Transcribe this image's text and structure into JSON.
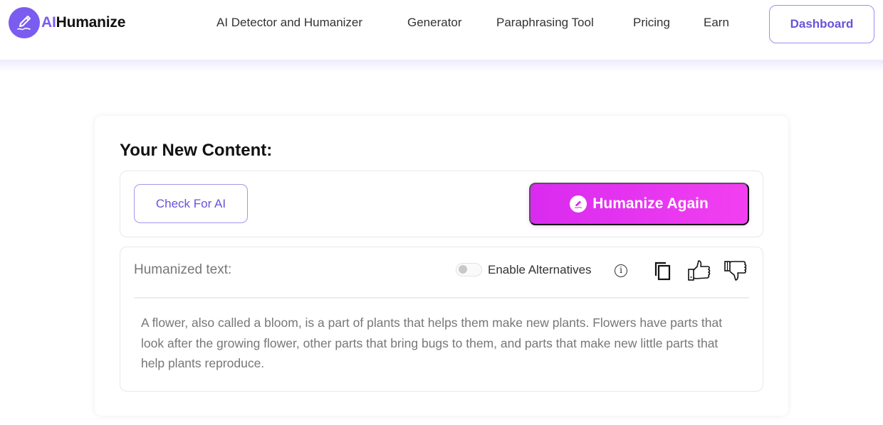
{
  "header": {
    "logo": {
      "prefix": "AI",
      "suffix": "Humanize",
      "icon": "pen-signature-icon"
    },
    "nav": [
      {
        "label": "AI Detector and Humanizer"
      },
      {
        "label": "Generator"
      },
      {
        "label": "Paraphrasing Tool"
      },
      {
        "label": "Pricing"
      },
      {
        "label": "Earn"
      }
    ],
    "dashboard_label": "Dashboard"
  },
  "content": {
    "title": "Your New Content:",
    "check_label": "Check For AI",
    "humanize_again_label": "Humanize Again",
    "humanized_label": "Humanized text:",
    "alternatives": {
      "label": "Enable Alternatives",
      "enabled": false
    },
    "icons": [
      "info-icon",
      "copy-icon",
      "thumbs-up-icon",
      "thumbs-down-icon"
    ],
    "text": "A flower, also called a bloom, is a part of plants that helps them make new plants. Flowers have parts that look after the growing flower, other parts that bring bugs to them, and parts that make new little parts that help plants reproduce."
  },
  "colors": {
    "brand": "#7b5cf0",
    "accent_gradient_start": "#d92bf0",
    "accent_gradient_end": "#f23ff0"
  }
}
